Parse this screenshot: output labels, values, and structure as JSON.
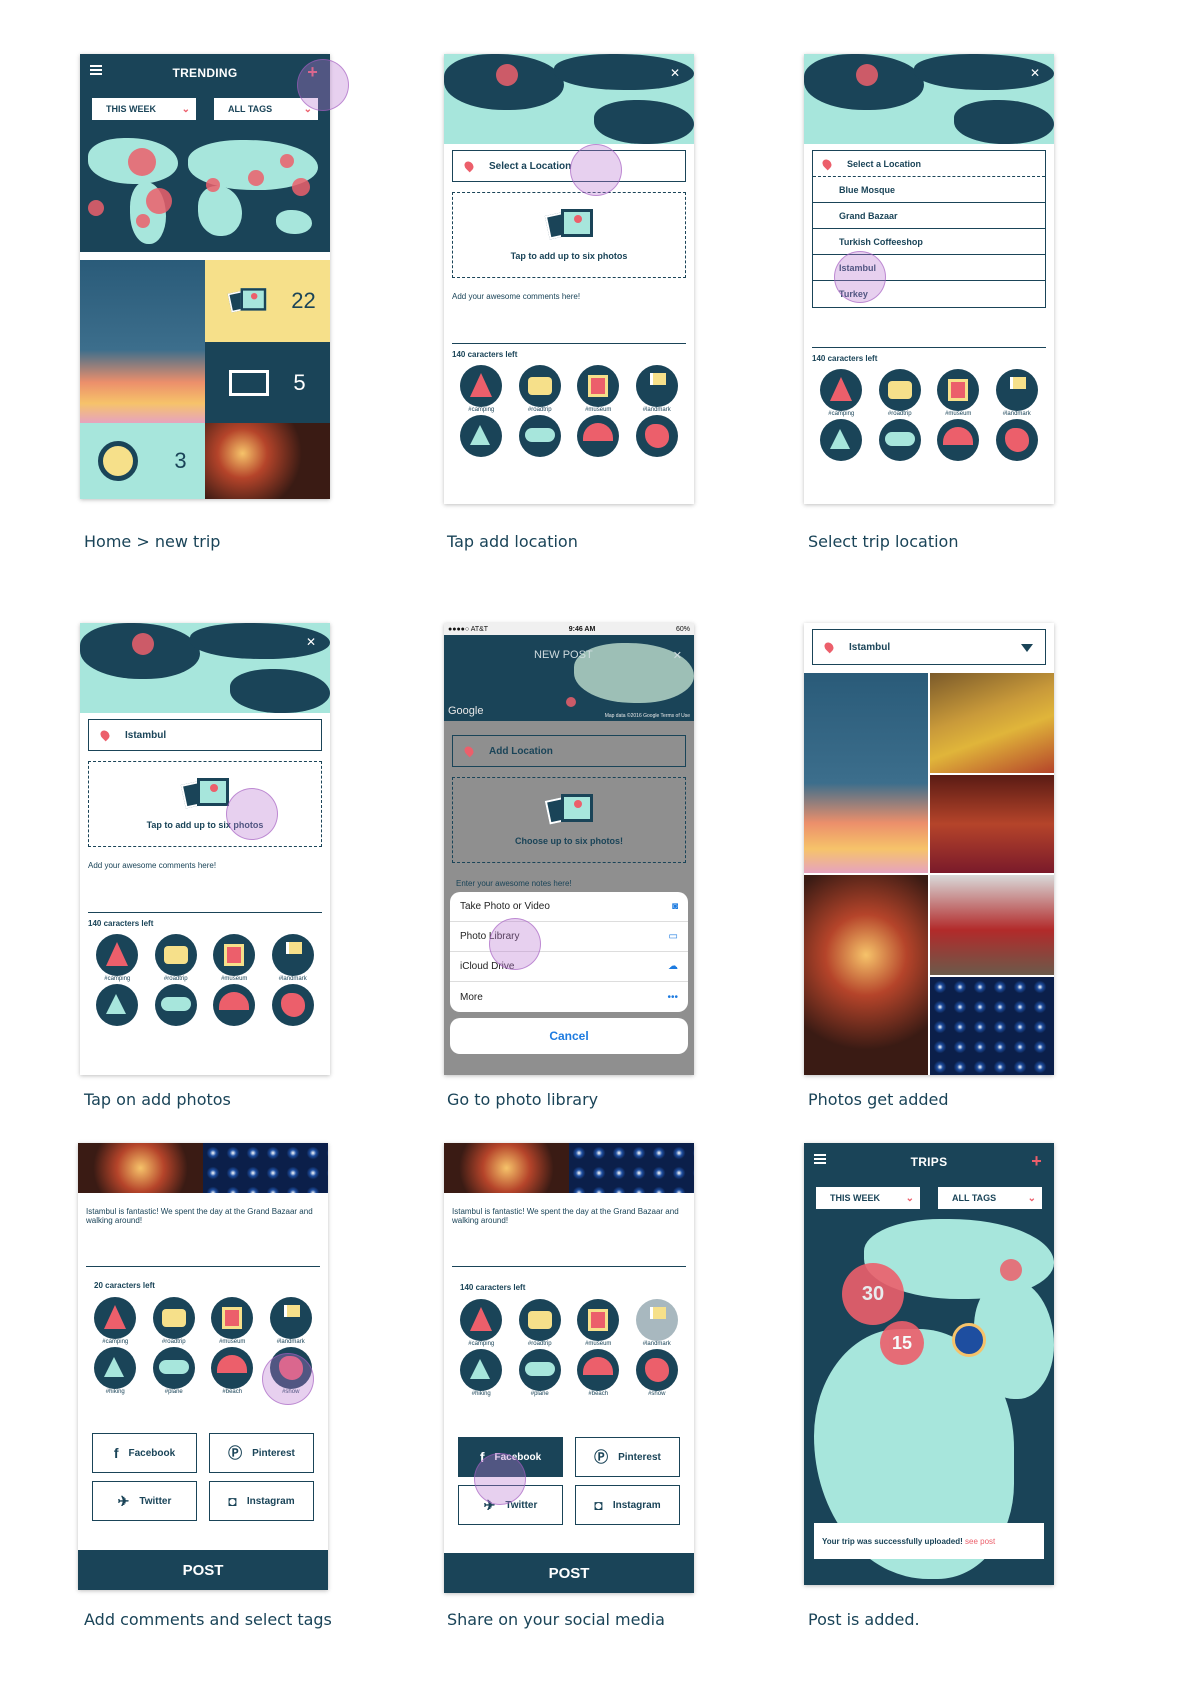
{
  "colors": {
    "navy": "#1a4458",
    "mint": "#a7e6dc",
    "coral": "#ec5f6b",
    "yellow": "#f6e08a"
  },
  "screen1": {
    "title": "TRENDING",
    "filter_week": "THIS WEEK",
    "filter_tags": "ALL TAGS",
    "count_photos": "22",
    "count_maps": "5",
    "count_misc": "3",
    "caption": "Home > new trip"
  },
  "screen2": {
    "location_placeholder": "Select a Location",
    "photo_prompt": "Tap to add up to six photos",
    "comment_placeholder": "Add your awesome comments here!",
    "chars_left": "140 caracters left",
    "caption": "Tap add location"
  },
  "screen3": {
    "dropdown": [
      "Select a Location",
      "Blue Mosque",
      "Grand Bazaar",
      "Turkish Coffeeshop",
      "Istambul",
      "Turkey"
    ],
    "chars_left": "140 caracters left",
    "caption": "Select trip location"
  },
  "screen4": {
    "location": "Istambul",
    "photo_prompt": "Tap to add up to six photos",
    "comment_placeholder": "Add your awesome comments here!",
    "chars_left": "140 caracters left",
    "caption": "Tap on add photos"
  },
  "screen5": {
    "status_carrier": "●●●●○ AT&T",
    "status_time": "9:46 AM",
    "status_battery": "60%",
    "title": "NEW POST",
    "google": "Google",
    "map_terms": "Map data ©2016 Google   Terms of Use",
    "add_location": "Add Location",
    "photo_prompt": "Choose up to six photos!",
    "notes": "Enter your awesome notes here!",
    "sheet": [
      "Take Photo or Video",
      "Photo Library",
      "iCloud Drive",
      "More"
    ],
    "cancel": "Cancel",
    "caption": "Go to photo library"
  },
  "screen6": {
    "location": "Istambul",
    "caption": "Photos get added"
  },
  "screen7": {
    "comment": "Istambul is fantastic! We spent the day at the Grand Bazaar and walking around!",
    "chars_left": "20 caracters left",
    "social": [
      "Facebook",
      "Pinterest",
      "Twitter",
      "Instagram"
    ],
    "post": "POST",
    "caption": "Add comments and select tags"
  },
  "screen8": {
    "comment": "Istambul is fantastic! We spent the day at the Grand Bazaar and walking around!",
    "chars_left": "140 caracters left",
    "social": [
      "Facebook",
      "Pinterest",
      "Twitter",
      "Instagram"
    ],
    "post": "POST",
    "caption": "Share on your social media"
  },
  "screen9": {
    "title": "TRIPS",
    "filter_week": "THIS WEEK",
    "filter_tags": "ALL TAGS",
    "cluster_large": "30",
    "cluster_small": "15",
    "toast_text": "Your trip was successfully uploaded!",
    "toast_link": "see post",
    "caption": "Post is added."
  },
  "tags_row1": [
    "#camping",
    "#roadtrip",
    "#museum",
    "#landmark"
  ],
  "tags_row2": [
    "#hiking",
    "#plane",
    "#beach",
    "#show"
  ]
}
